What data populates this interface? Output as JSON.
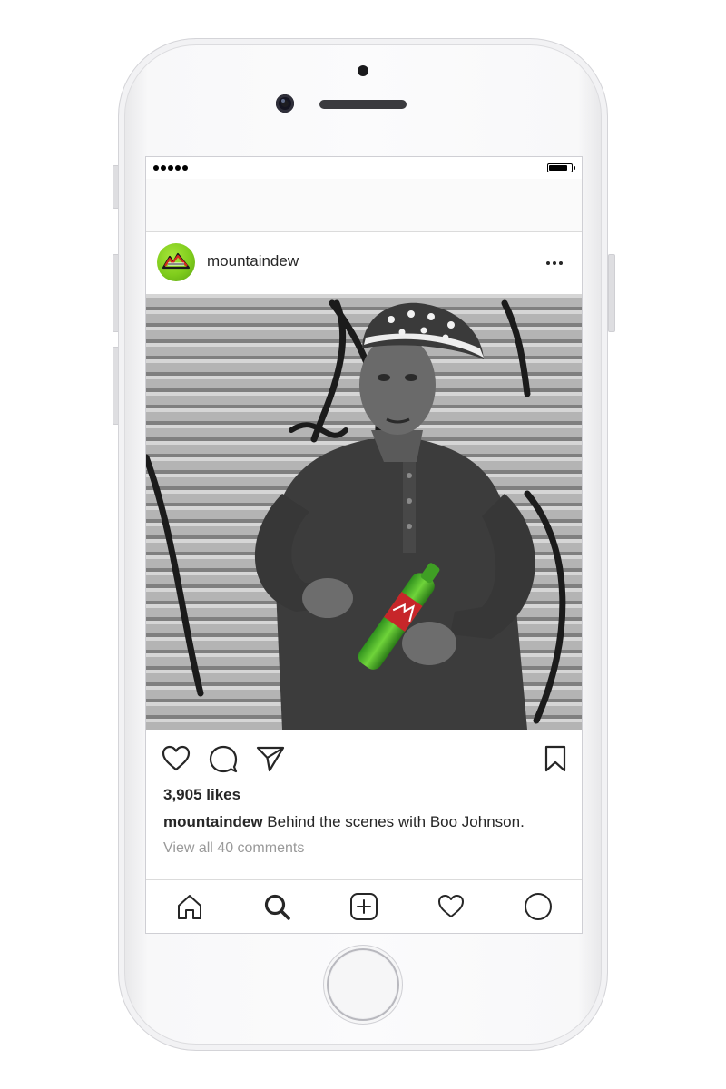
{
  "post": {
    "username": "mountaindew",
    "likes": "3,905 likes",
    "caption_user": "mountaindew",
    "caption_text": " Behind the scenes with Boo Johnson.",
    "comments_link": "View all 40 comments"
  },
  "status_bar": {
    "signal_bars": 5,
    "battery_level": 0.85
  },
  "icons": {
    "header": [
      "more-options-icon"
    ],
    "actions": [
      "heart-icon",
      "comment-icon",
      "share-icon",
      "bookmark-icon"
    ],
    "tab_bar": [
      "home-icon",
      "search-icon",
      "add-post-icon",
      "activity-heart-icon",
      "profile-icon"
    ]
  },
  "colors": {
    "brand_green": "#7fcc1c",
    "bottle_green": "#4fb82a",
    "text": "#262626",
    "secondary_text": "#999999",
    "divider": "#dbdbdb"
  }
}
